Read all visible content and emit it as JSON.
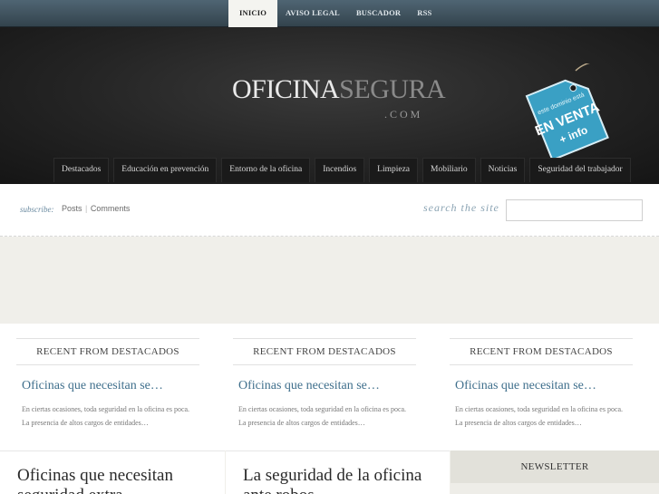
{
  "top_nav": {
    "items": [
      {
        "label": "INICIO",
        "active": true
      },
      {
        "label": "AVISO LEGAL",
        "active": false
      },
      {
        "label": "BUSCADOR",
        "active": false
      },
      {
        "label": "RSS",
        "active": false
      }
    ]
  },
  "header": {
    "logo_part1": "OFICINA",
    "logo_part2": "SEGURA",
    "logo_suffix": ".COM",
    "sale_tag": {
      "line1": "este dominio está",
      "line2": "EN VENTA",
      "line3": "+ info"
    }
  },
  "category_nav": {
    "items": [
      "Destacados",
      "Educación en prevención",
      "Entorno de la oficina",
      "Incendios",
      "Limpieza",
      "Mobiliario",
      "Noticias",
      "Seguridad del trabajador"
    ]
  },
  "subscribe_bar": {
    "subscribe_label": "subscribe:",
    "posts_link": "Posts",
    "separator": "|",
    "comments_link": "Comments",
    "search_label": "search the site",
    "search_value": ""
  },
  "recent": [
    {
      "heading": "RECENT FROM DESTACADOS",
      "title": "Oficinas que necesitan se…",
      "excerpt": "En ciertas ocasiones, toda seguridad en la oficina es poca. La presencia de altos cargos de entidades…"
    },
    {
      "heading": "RECENT FROM DESTACADOS",
      "title": "Oficinas que necesitan se…",
      "excerpt": "En ciertas ocasiones, toda seguridad en la oficina es poca. La presencia de altos cargos de entidades…"
    },
    {
      "heading": "RECENT FROM DESTACADOS",
      "title": "Oficinas que necesitan se…",
      "excerpt": "En ciertas ocasiones, toda seguridad en la oficina es poca. La presencia de altos cargos de entidades…"
    }
  ],
  "posts": [
    {
      "title": "Oficinas que necesitan seguridad extra"
    },
    {
      "title": "La seguridad de la oficina ante robos"
    }
  ],
  "newsletter": {
    "heading": "NEWSLETTER"
  },
  "colors": {
    "accent_link": "#3f6f8c",
    "tag_blue": "#3aa0c4",
    "topbar": "#3d505c"
  }
}
